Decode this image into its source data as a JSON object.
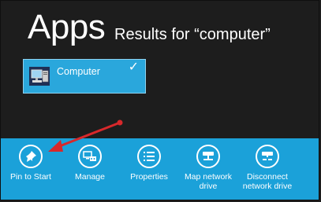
{
  "header": {
    "title": "Apps",
    "subtitle": "Results for “computer”"
  },
  "result_tile": {
    "label": "Computer",
    "icon": "computer-icon",
    "check": "✓",
    "selected": true
  },
  "app_bar": {
    "commands": [
      {
        "label": "Pin to Start",
        "icon": "pin-icon"
      },
      {
        "label": "Manage",
        "icon": "manage-computer-icon"
      },
      {
        "label": "Properties",
        "icon": "properties-list-icon"
      },
      {
        "label": "Map network drive",
        "icon": "network-drive-icon"
      },
      {
        "label": "Disconnect network drive",
        "icon": "disconnect-network-drive-icon"
      }
    ]
  },
  "annotation": {
    "arrow_color": "#d7282b"
  },
  "colors": {
    "background": "#1d1d1d",
    "accent": "#1ba1d9",
    "tile": "#2aa7dc"
  }
}
